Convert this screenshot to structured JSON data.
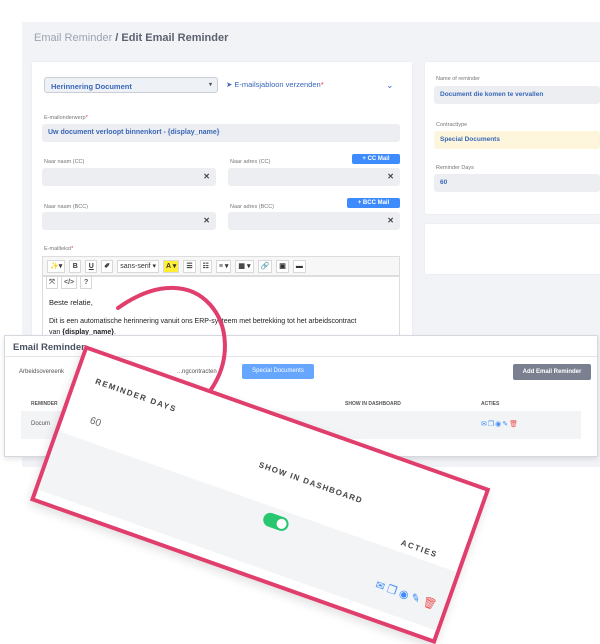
{
  "breadcrumb": {
    "parent": "Email Reminder",
    "separator": " / ",
    "current": "Edit Email Reminder"
  },
  "form": {
    "template_select": "Herinnering Document",
    "send_template_label": "E-mailsjabloon verzenden",
    "subject_label": "E-mailonderwerp",
    "subject_value": "Uw document verloopt binnenkort - {display_name}",
    "cc_name_label": "Naar naam (CC)",
    "cc_addr_label": "Naar adres (CC)",
    "cc_button": "+ CC Mail",
    "bcc_name_label": "Naar naam (BCC)",
    "bcc_addr_label": "Naar adres (BCC)",
    "bcc_button": "+ BCC Mail",
    "body_label": "E-mailtekst",
    "clear_glyph": "✕",
    "toolbar": {
      "magic": "✨▾",
      "bold": "B",
      "underline": "U",
      "eraser": "✐",
      "font": "sans-serif ▾",
      "color": "A ▾",
      "ul": "☰",
      "ol": "☷",
      "align": "≡ ▾",
      "table": "▦ ▾",
      "link": "🔗",
      "image": "▣",
      "video": "▬",
      "fullscreen": "⤧",
      "code": "</>",
      "help": "?"
    },
    "body_line1": "Beste relatie,",
    "body_line2": "Dit is een automatische herinnering vanuit ons ERP-systeem met betrekking tot het arbeidscontract",
    "body_line3_prefix": "van ",
    "body_line3_bold": "{display_name}",
    "body_line3_suffix": "."
  },
  "side": {
    "name_label": "Name of reminder",
    "name_value": "Document die komen te vervallen",
    "type_label": "Contracttype",
    "type_value": "Special Documents",
    "days_label": "Reminder Days",
    "days_value": "60"
  },
  "list": {
    "title": "Email Reminder",
    "tab_first": "Arbeidsovereenk",
    "tab_middle": "...ngcontracten",
    "tab_active": "Special Documents",
    "add_button": "Add Email Reminder",
    "col_reminder": "REMINDER",
    "col_show": "SHOW IN DASHBOARD",
    "col_actions": "ACTIES",
    "row_name": "Docum"
  },
  "zoom": {
    "col_days": "REMINDER DAYS",
    "col_show": "SHOW IN DASHBOARD",
    "col_actions": "ACTIES",
    "days_value": "60",
    "toggle_on": true
  },
  "colors": {
    "accent": "#3d8bfd",
    "highlight": "#e03e6c",
    "toggle": "#28c76f",
    "danger": "#ea5455"
  }
}
